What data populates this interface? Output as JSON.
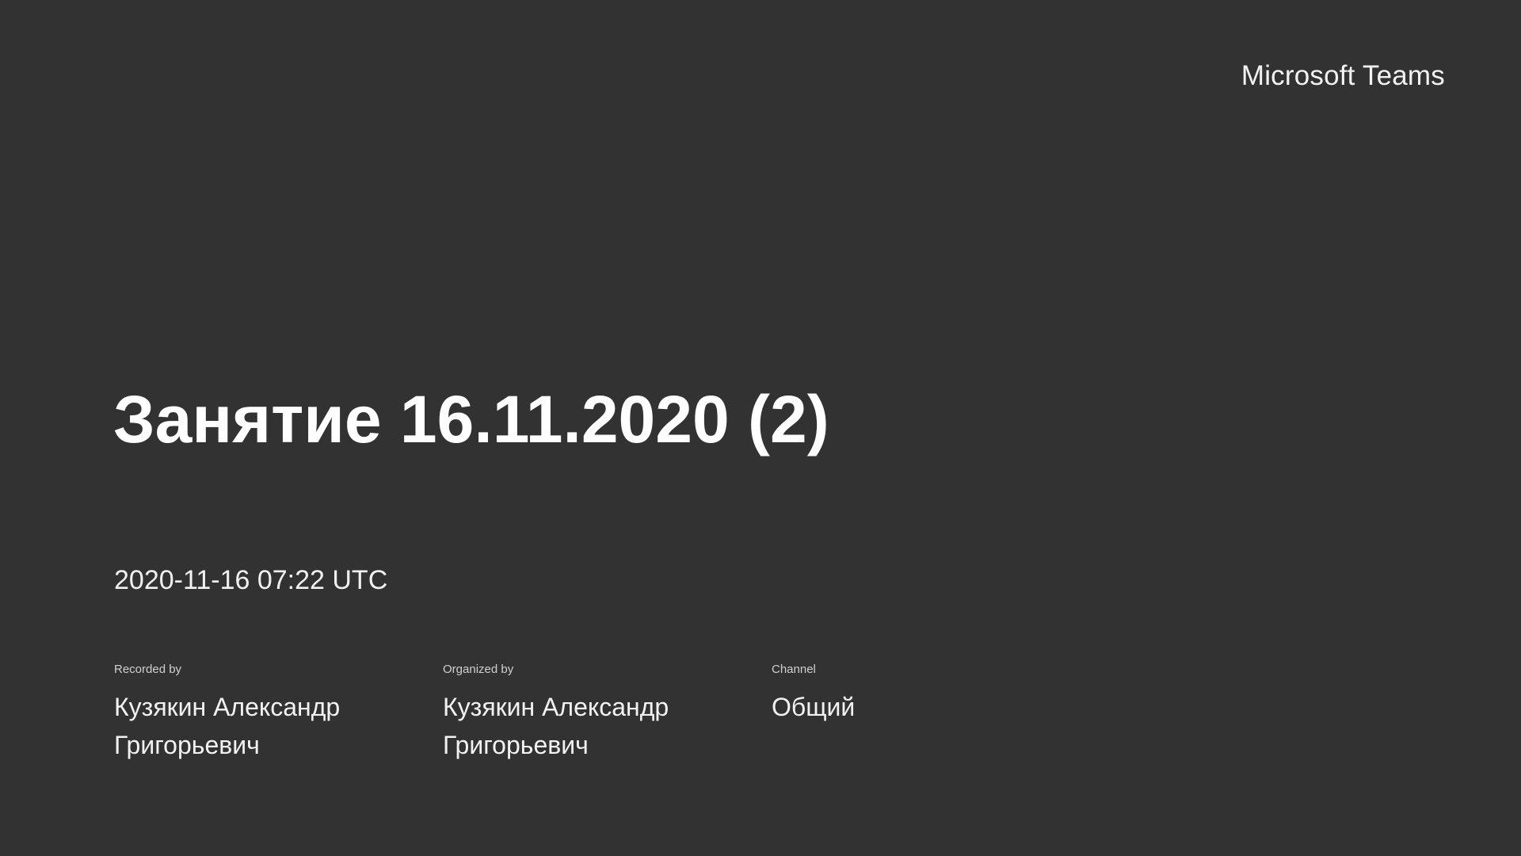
{
  "header": {
    "brand": "Microsoft Teams"
  },
  "meeting": {
    "title": "Занятие 16.11.2020 (2)",
    "datetime": "2020-11-16 07:22 UTC"
  },
  "details": [
    {
      "label": "Recorded by",
      "value": "Кузякин Александр Григорьевич"
    },
    {
      "label": "Organized by",
      "value": "Кузякин Александр Григорьевич"
    },
    {
      "label": "Channel",
      "value": "Общий"
    }
  ],
  "colors": {
    "background": "#323232",
    "text": "#ffffff"
  }
}
